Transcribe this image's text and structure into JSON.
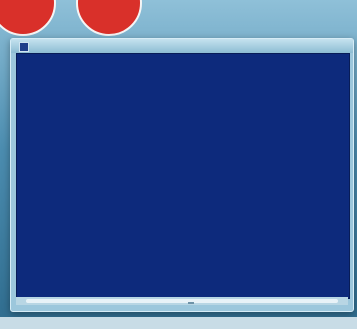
{
  "window": {
    "title": ""
  },
  "console": {
    "command_line": "",
    "directory_line": "",
    "headers": {
      "mode": "",
      "last_write_time": "",
      "length": "",
      "name": ""
    },
    "rows": [
      {
        "mode": "",
        "date": "",
        "time": "",
        "ampm": "",
        "name": ""
      },
      {
        "mode": "",
        "date": "",
        "time": "",
        "ampm": "",
        "name": ""
      },
      {
        "mode": "",
        "date": "",
        "time": "",
        "ampm": "",
        "name": ""
      },
      {
        "mode": "",
        "date": "",
        "time": "",
        "ampm": "",
        "name": ""
      },
      {
        "mode": "",
        "date": "",
        "time": "",
        "ampm": "",
        "name": ""
      },
      {
        "mode": "",
        "date": "",
        "time": "",
        "ampm": "",
        "name": ""
      },
      {
        "mode": "",
        "date": "",
        "time": "",
        "ampm": "",
        "name": ""
      },
      {
        "mode": "",
        "date": "",
        "time": "",
        "ampm": "",
        "name": ""
      },
      {
        "mode": "",
        "date": "",
        "time": "",
        "ampm": "",
        "name": ""
      },
      {
        "mode": "",
        "date": "",
        "time": "",
        "ampm": "",
        "name": ""
      }
    ],
    "prompt_line": ""
  },
  "colors": {
    "console_background": "#0d2a7c",
    "console_text": "#d8dde8",
    "window_frame": "#9cc7dc",
    "badge_red": "#d9302a"
  },
  "icons": {
    "title_icon": "powershell-icon"
  }
}
